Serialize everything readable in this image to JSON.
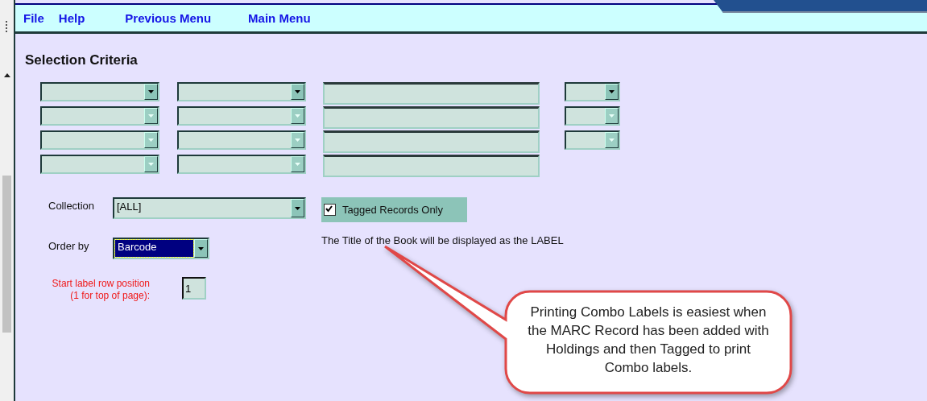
{
  "menu": [
    {
      "label": "File"
    },
    {
      "label": "Help"
    },
    {
      "label": "Previous Menu"
    },
    {
      "label": "Main Menu"
    }
  ],
  "section_title": "Selection Criteria",
  "criteria": {
    "columns": [
      {
        "kind": "dropdown",
        "rows": [
          {
            "disabled": false
          },
          {
            "disabled": true
          },
          {
            "disabled": true
          },
          {
            "disabled": true
          }
        ]
      },
      {
        "kind": "dropdown",
        "rows": [
          {
            "disabled": false
          },
          {
            "disabled": true
          },
          {
            "disabled": true
          },
          {
            "disabled": true
          }
        ]
      },
      {
        "kind": "text",
        "rows": [
          {
            "disabled": false
          },
          {
            "disabled": false
          },
          {
            "disabled": false
          },
          {
            "disabled": false
          }
        ]
      },
      {
        "kind": "dropdown",
        "rows": [
          {
            "disabled": false
          },
          {
            "disabled": true
          },
          {
            "disabled": true
          }
        ]
      }
    ]
  },
  "collection": {
    "label": "Collection",
    "value": "[ALL]"
  },
  "order_by": {
    "label": "Order by",
    "value": "Barcode",
    "focused": true
  },
  "start_row": {
    "label": "Start label row position\n(1 for top of page):",
    "value": "1"
  },
  "tagged_only": {
    "label": "Tagged Records Only",
    "checked": true
  },
  "note": "The Title of the Book will be displayed as the LABEL",
  "callout": {
    "text": "Printing Combo Labels is easiest when the MARC Record has been added with Holdings and then Tagged to print Combo labels."
  }
}
